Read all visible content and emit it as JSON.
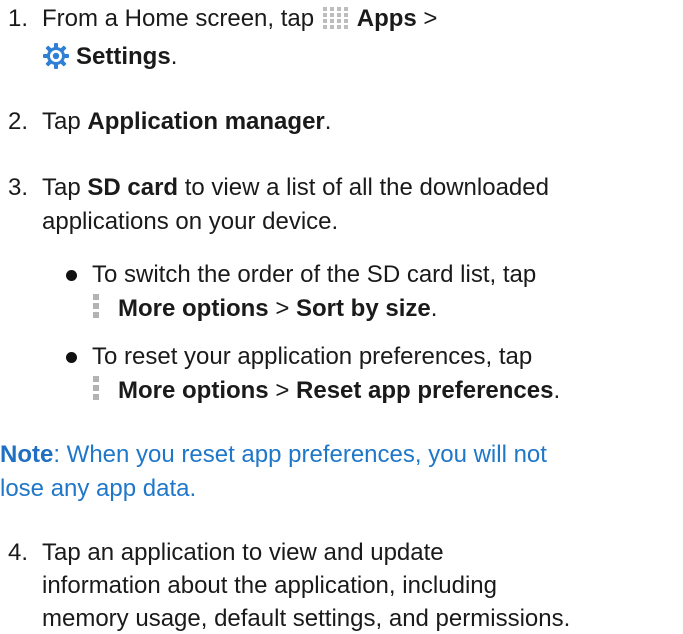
{
  "steps": [
    {
      "num": "1.",
      "text1": "From a Home screen, tap ",
      "apps_label": "Apps",
      "sep1": " >",
      "settings_label": "Settings",
      "end": "."
    },
    {
      "num": "2.",
      "text1": "Tap ",
      "bold": "Application manager",
      "end": "."
    },
    {
      "num": "3.",
      "text1": "Tap ",
      "bold": "SD card",
      "text2": " to view a list of all the downloaded",
      "line2": "applications on your device."
    },
    {
      "num": "4.",
      "line1": "Tap an application to view and update",
      "line2": "information about the application, including",
      "line3": "memory usage, default settings, and permissions."
    }
  ],
  "bullets": [
    {
      "line1": "To switch the order of the SD card list, tap",
      "bold1": "More options",
      "sep": " > ",
      "bold2": "Sort by size",
      "end": "."
    },
    {
      "line1": "To reset your application preferences, tap",
      "bold1": "More options",
      "sep": " > ",
      "bold2": "Reset app preferences",
      "end": "."
    }
  ],
  "note": {
    "label": "Note",
    "line1": ": When you reset app preferences, you will not",
    "line2": "lose any app data."
  },
  "icons": {
    "apps": "apps-grid-icon",
    "settings": "settings-gear-icon",
    "more": "more-options-icon"
  },
  "colors": {
    "note": "#1f77c9",
    "settings_icon": "#2f7fd6"
  }
}
